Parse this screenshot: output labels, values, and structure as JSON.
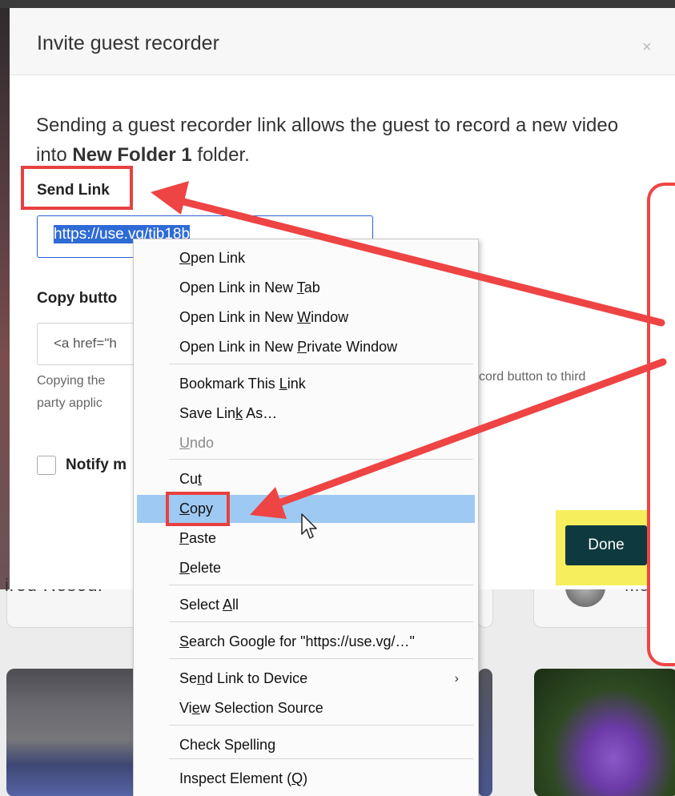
{
  "background": {
    "partial_text_left": "ired Resour",
    "partial_text_right": "Me"
  },
  "modal": {
    "title": "Invite guest recorder",
    "close_glyph": "×",
    "description_prefix": "Sending a guest recorder link allows the guest to record a new video into ",
    "folder_name": "New Folder 1",
    "description_suffix": " folder.",
    "send_link_label": "Send Link",
    "link_value": "https://use.vg/tib18b",
    "copy_button_label": "Copy butto",
    "code_value": "<a href=\"h",
    "help_text_left": "Copying the",
    "help_text_left_2": "party applic",
    "help_text_right": "cord button to third",
    "notify_label": "Notify m",
    "done_label": "Done"
  },
  "context_menu": {
    "items": [
      {
        "pre": "",
        "ul": "O",
        "post": "pen Link"
      },
      {
        "pre": "Open Link in New ",
        "ul": "T",
        "post": "ab"
      },
      {
        "pre": "Open Link in New ",
        "ul": "W",
        "post": "indow"
      },
      {
        "pre": "Open Link in New ",
        "ul": "P",
        "post": "rivate Window"
      },
      {
        "pre": "Bookmark This ",
        "ul": "L",
        "post": "ink"
      },
      {
        "pre": "Save Lin",
        "ul": "k",
        "post": " As…"
      },
      {
        "pre": "",
        "ul": "U",
        "post": "ndo"
      },
      {
        "pre": "Cu",
        "ul": "t",
        "post": ""
      },
      {
        "pre": "",
        "ul": "C",
        "post": "opy"
      },
      {
        "pre": "",
        "ul": "P",
        "post": "aste"
      },
      {
        "pre": "",
        "ul": "D",
        "post": "elete"
      },
      {
        "pre": "Select ",
        "ul": "A",
        "post": "ll"
      },
      {
        "pre": "",
        "ul": "S",
        "post": "earch Google for \"https://use.vg/…\""
      },
      {
        "pre": "Se",
        "ul": "n",
        "post": "d Link to Device"
      },
      {
        "pre": "Vi",
        "ul": "e",
        "post": "w Selection Source"
      },
      {
        "pre": "Check Spellin",
        "ul": "g",
        "post": ""
      },
      {
        "pre": "Inspect Element (",
        "ul": "Q",
        "post": ")"
      }
    ],
    "submenu_arrow": "›"
  },
  "colors": {
    "annotation_red": "#e84040",
    "highlight_yellow": "#f6ee5c",
    "done_button": "#0e3a3f",
    "menu_highlight": "#9ec9f2",
    "selection_blue": "#2f6bd6"
  }
}
